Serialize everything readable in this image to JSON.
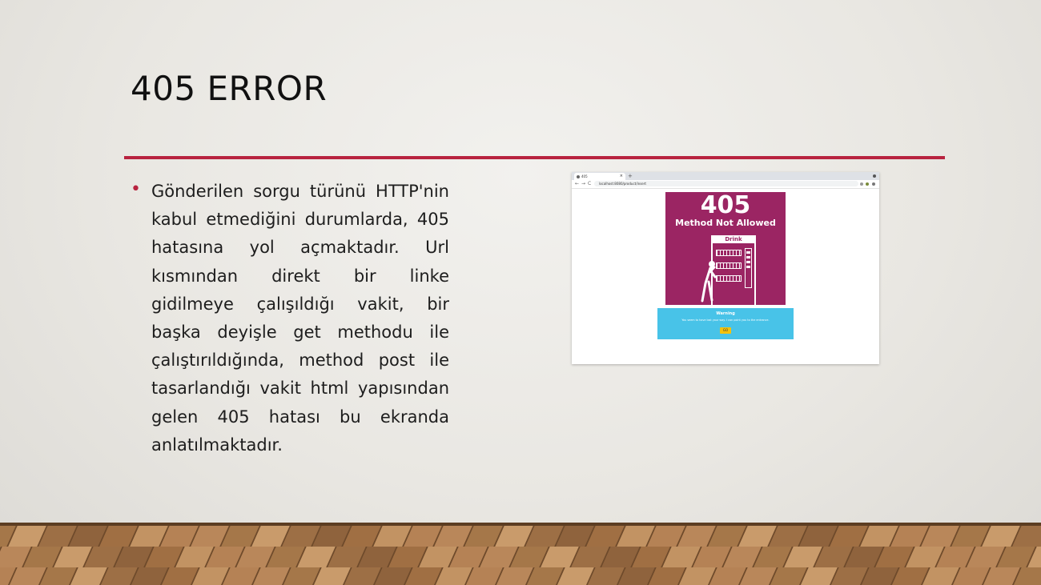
{
  "slide": {
    "title": "405 ERROR",
    "accent_color": "#b8233f",
    "bullet_marker": "•",
    "bullet_text": "Gönderilen sorgu türünü HTTP'nin kabul etmediğini durumlarda, 405 hatasına yol açmaktadır. Url kısmından direkt bir linke gidilmeye çalışıldığı vakit, bir başka deyişle get methodu ile çalıştırıldığında, method post ile tasarlandığı vakit html yapısından gelen 405 hatası bu ekranda anlatılmaktadır."
  },
  "screenshot": {
    "tab_label": "405",
    "tab_close": "×",
    "new_tab": "+",
    "nav_back": "←",
    "nav_forward": "→",
    "nav_reload": "C",
    "url": "localhost:8080/product/insert",
    "poster": {
      "code": "405",
      "subtitle": "Method Not Allowed",
      "sign": "Drink",
      "background": "#9b2563"
    },
    "warning": {
      "title": "Warning",
      "text": "You seem to have lost your way. I can point you to the entrance.",
      "button": "GO",
      "background": "#48c3e8",
      "button_color": "#f4c20d"
    }
  }
}
